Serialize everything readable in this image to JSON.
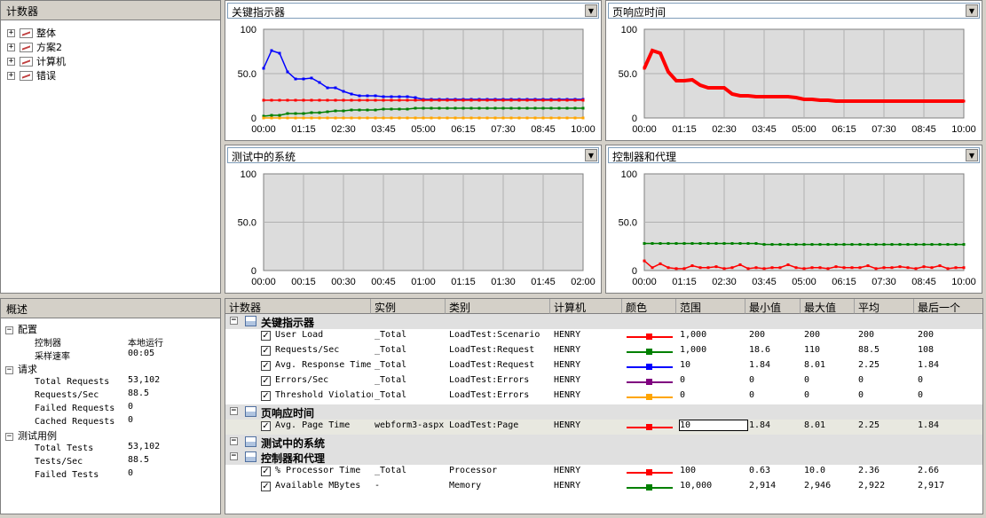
{
  "counters_panel": {
    "title": "计数器",
    "items": [
      {
        "label": "整体"
      },
      {
        "label": "方案2"
      },
      {
        "label": "计算机"
      },
      {
        "label": "错误"
      }
    ]
  },
  "graphs": [
    {
      "title": "关键指示器",
      "x_ticks": [
        "00:00",
        "01:15",
        "02:30",
        "03:45",
        "05:00",
        "06:15",
        "07:30",
        "08:45",
        "10:00"
      ],
      "y_ticks": [
        "100",
        "50.0",
        "0"
      ]
    },
    {
      "title": "页响应时间",
      "x_ticks": [
        "00:00",
        "01:15",
        "02:30",
        "03:45",
        "05:00",
        "06:15",
        "07:30",
        "08:45",
        "10:00"
      ],
      "y_ticks": [
        "100",
        "50.0",
        "0"
      ]
    },
    {
      "title": "测试中的系统",
      "x_ticks": [
        "00:00",
        "00:15",
        "00:30",
        "00:45",
        "01:00",
        "01:15",
        "01:30",
        "01:45",
        "02:00"
      ],
      "y_ticks": [
        "100",
        "50.0",
        "0"
      ]
    },
    {
      "title": "控制器和代理",
      "x_ticks": [
        "00:00",
        "01:15",
        "02:30",
        "03:45",
        "05:00",
        "06:15",
        "07:30",
        "08:45",
        "10:00"
      ],
      "y_ticks": [
        "100",
        "50.0",
        "0"
      ]
    }
  ],
  "chart_data": [
    {
      "type": "line",
      "title": "关键指示器",
      "ylim": [
        0,
        100
      ],
      "x": [
        "00:00",
        "00:15",
        "00:30",
        "00:45",
        "01:00",
        "01:15",
        "01:30",
        "01:45",
        "02:00",
        "02:15",
        "02:30",
        "02:45",
        "03:00",
        "03:15",
        "03:30",
        "03:45",
        "04:00",
        "04:15",
        "04:30",
        "04:45",
        "05:00",
        "05:15",
        "05:30",
        "05:45",
        "06:00",
        "06:15",
        "06:30",
        "06:45",
        "07:00",
        "07:15",
        "07:30",
        "07:45",
        "08:00",
        "08:15",
        "08:30",
        "08:45",
        "09:00",
        "09:15",
        "09:30",
        "09:45",
        "10:00"
      ],
      "series": [
        {
          "color": "#0000ff",
          "values": [
            56,
            76,
            73,
            52,
            44,
            44,
            45,
            40,
            34,
            34,
            30,
            27,
            25,
            25,
            25,
            24,
            24,
            24,
            24,
            23,
            21,
            21,
            21,
            21,
            21,
            21,
            21,
            21,
            21,
            21,
            21,
            21,
            21,
            21,
            21,
            21,
            21,
            21,
            21,
            21,
            21
          ]
        },
        {
          "color": "#ff0000",
          "values": [
            20,
            20,
            20,
            20,
            20,
            20,
            20,
            20,
            20,
            20,
            20,
            20,
            20,
            20,
            20,
            20,
            20,
            20,
            20,
            20,
            20,
            20,
            20,
            20,
            20,
            20,
            20,
            20,
            20,
            20,
            20,
            20,
            20,
            20,
            20,
            20,
            20,
            20,
            20,
            20,
            20
          ]
        },
        {
          "color": "#008000",
          "values": [
            2,
            3,
            3,
            5,
            5,
            5,
            6,
            6,
            7,
            8,
            8,
            9,
            9,
            9,
            9,
            10,
            10,
            10,
            10,
            11,
            11,
            11,
            11,
            11,
            11,
            11,
            11,
            11,
            11,
            11,
            11,
            11,
            11,
            11,
            11,
            11,
            11,
            11,
            11,
            11,
            11
          ]
        },
        {
          "color": "#ffa500",
          "values": [
            0,
            0,
            0,
            0,
            0,
            0,
            0,
            0,
            0,
            0,
            0,
            0,
            0,
            0,
            0,
            0,
            0,
            0,
            0,
            0,
            0,
            0,
            0,
            0,
            0,
            0,
            0,
            0,
            0,
            0,
            0,
            0,
            0,
            0,
            0,
            0,
            0,
            0,
            0,
            0,
            0
          ]
        }
      ]
    },
    {
      "type": "line",
      "title": "页响应时间",
      "ylim": [
        0,
        100
      ],
      "x": [
        "00:00",
        "00:15",
        "00:30",
        "00:45",
        "01:00",
        "01:15",
        "01:30",
        "01:45",
        "02:00",
        "02:15",
        "02:30",
        "02:45",
        "03:00",
        "03:15",
        "03:30",
        "03:45",
        "04:00",
        "04:15",
        "04:30",
        "04:45",
        "05:00",
        "05:15",
        "05:30",
        "05:45",
        "06:00",
        "06:15",
        "06:30",
        "06:45",
        "07:00",
        "07:15",
        "07:30",
        "07:45",
        "08:00",
        "08:15",
        "08:30",
        "08:45",
        "09:00",
        "09:15",
        "09:30",
        "09:45",
        "10:00"
      ],
      "series": [
        {
          "color": "#ff0000",
          "values": [
            56,
            76,
            73,
            52,
            42,
            42,
            43,
            37,
            34,
            34,
            34,
            27,
            25,
            25,
            24,
            24,
            24,
            24,
            24,
            23,
            21,
            21,
            20,
            20,
            19,
            19,
            19,
            19,
            19,
            19,
            19,
            19,
            19,
            19,
            19,
            19,
            19,
            19,
            19,
            19,
            19
          ]
        }
      ]
    },
    {
      "type": "line",
      "title": "测试中的系统",
      "ylim": [
        0,
        100
      ],
      "series": []
    },
    {
      "type": "line",
      "title": "控制器和代理",
      "ylim": [
        0,
        100
      ],
      "x": [
        "00:00",
        "00:15",
        "00:30",
        "00:45",
        "01:00",
        "01:15",
        "01:30",
        "01:45",
        "02:00",
        "02:15",
        "02:30",
        "02:45",
        "03:00",
        "03:15",
        "03:30",
        "03:45",
        "04:00",
        "04:15",
        "04:30",
        "04:45",
        "05:00",
        "05:15",
        "05:30",
        "05:45",
        "06:00",
        "06:15",
        "06:30",
        "06:45",
        "07:00",
        "07:15",
        "07:30",
        "07:45",
        "08:00",
        "08:15",
        "08:30",
        "08:45",
        "09:00",
        "09:15",
        "09:30",
        "09:45",
        "10:00"
      ],
      "series": [
        {
          "color": "#008000",
          "values": [
            28,
            28,
            28,
            28,
            28,
            28,
            28,
            28,
            28,
            28,
            28,
            28,
            28,
            28,
            28,
            27,
            27,
            27,
            27,
            27,
            27,
            27,
            27,
            27,
            27,
            27,
            27,
            27,
            27,
            27,
            27,
            27,
            27,
            27,
            27,
            27,
            27,
            27,
            27,
            27,
            27
          ]
        },
        {
          "color": "#ff0000",
          "values": [
            10,
            3,
            7,
            3,
            2,
            2,
            5,
            3,
            3,
            4,
            2,
            3,
            6,
            2,
            3,
            2,
            3,
            3,
            6,
            3,
            2,
            3,
            3,
            2,
            4,
            3,
            3,
            3,
            5,
            2,
            3,
            3,
            4,
            3,
            2,
            4,
            3,
            5,
            2,
            3,
            3
          ]
        }
      ]
    }
  ],
  "overview": {
    "title": "概述",
    "sections": [
      {
        "label": "配置",
        "rows": [
          {
            "k": "控制器",
            "v": "本地运行"
          },
          {
            "k": "采样速率",
            "v": "00:05"
          }
        ]
      },
      {
        "label": "请求",
        "rows": [
          {
            "k": "Total Requests",
            "v": "53,102"
          },
          {
            "k": "Requests/Sec",
            "v": "88.5"
          },
          {
            "k": "Failed Requests",
            "v": "0"
          },
          {
            "k": "Cached Requests",
            "v": "0"
          }
        ]
      },
      {
        "label": "测试用例",
        "rows": [
          {
            "k": "Total Tests",
            "v": "53,102"
          },
          {
            "k": "Tests/Sec",
            "v": "88.5"
          },
          {
            "k": "Failed Tests",
            "v": "0"
          }
        ]
      }
    ]
  },
  "grid": {
    "headers": [
      "计数器",
      "实例",
      "类别",
      "计算机",
      "颜色",
      "范围",
      "最小值",
      "最大值",
      "平均",
      "最后一个"
    ],
    "groups": [
      {
        "label": "关键指示器",
        "rows": [
          {
            "counter": "User Load",
            "instance": "_Total",
            "category": "LoadTest:Scenario",
            "computer": "HENRY",
            "color": "#ff0000",
            "range": "1,000",
            "min": "200",
            "max": "200",
            "avg": "200",
            "last": "200"
          },
          {
            "counter": "Requests/Sec",
            "instance": "_Total",
            "category": "LoadTest:Request",
            "computer": "HENRY",
            "color": "#008000",
            "range": "1,000",
            "min": "18.6",
            "max": "110",
            "avg": "88.5",
            "last": "108"
          },
          {
            "counter": "Avg. Response Time",
            "instance": "_Total",
            "category": "LoadTest:Request",
            "computer": "HENRY",
            "color": "#0000ff",
            "range": "10",
            "min": "1.84",
            "max": "8.01",
            "avg": "2.25",
            "last": "1.84"
          },
          {
            "counter": "Errors/Sec",
            "instance": "_Total",
            "category": "LoadTest:Errors",
            "computer": "HENRY",
            "color": "#800080",
            "range": "0",
            "min": "0",
            "max": "0",
            "avg": "0",
            "last": "0"
          },
          {
            "counter": "Threshold Violation",
            "instance": "_Total",
            "category": "LoadTest:Errors",
            "computer": "HENRY",
            "color": "#ffa500",
            "range": "0",
            "min": "0",
            "max": "0",
            "avg": "0",
            "last": "0"
          }
        ]
      },
      {
        "label": "页响应时间",
        "rows": [
          {
            "counter": "Avg. Page Time",
            "instance": "webform3-aspx",
            "category": "LoadTest:Page",
            "computer": "HENRY",
            "color": "#ff0000",
            "range": "10",
            "min": "1.84",
            "max": "8.01",
            "avg": "2.25",
            "last": "1.84",
            "selected": true
          }
        ]
      },
      {
        "label": "测试中的系统",
        "rows": []
      },
      {
        "label": "控制器和代理",
        "rows": [
          {
            "counter": "% Processor Time",
            "instance": "_Total",
            "category": "Processor",
            "computer": "HENRY",
            "color": "#ff0000",
            "range": "100",
            "min": "0.63",
            "max": "10.0",
            "avg": "2.36",
            "last": "2.66"
          },
          {
            "counter": "Available MBytes",
            "instance": "-",
            "category": "Memory",
            "computer": "HENRY",
            "color": "#008000",
            "range": "10,000",
            "min": "2,914",
            "max": "2,946",
            "avg": "2,922",
            "last": "2,917"
          }
        ]
      }
    ]
  }
}
